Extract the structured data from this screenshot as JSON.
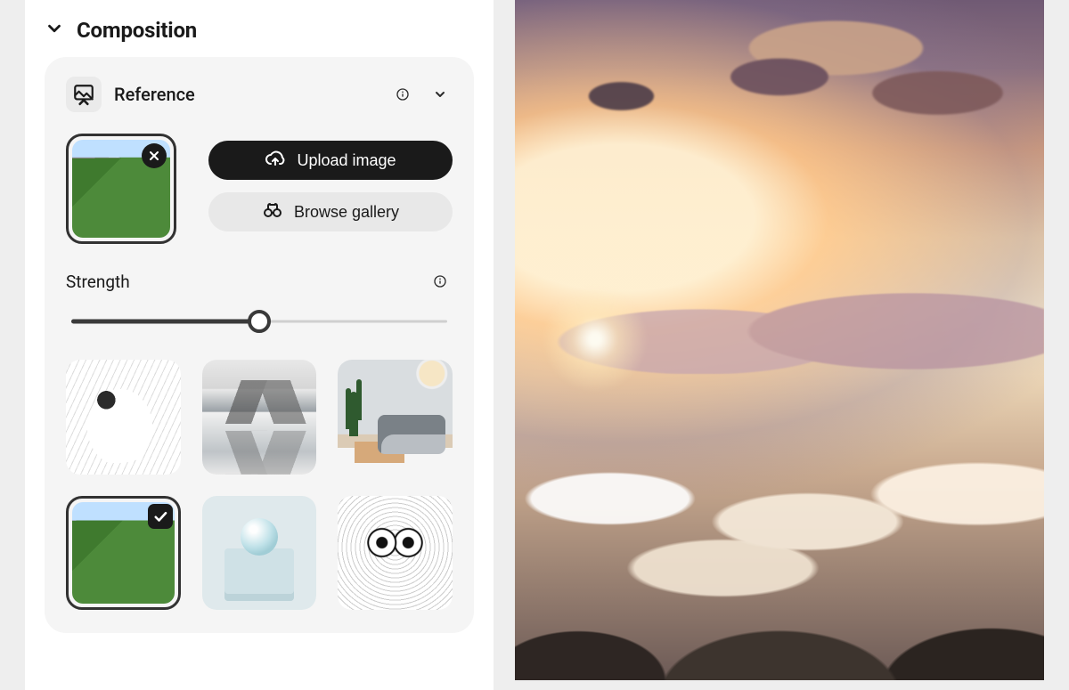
{
  "composition": {
    "section_title": "Composition",
    "reference": {
      "title": "Reference",
      "upload_label": "Upload image",
      "browse_label": "Browse gallery"
    },
    "strength": {
      "label": "Strength",
      "value_percent": 50
    },
    "gallery_selected_index": 3
  }
}
